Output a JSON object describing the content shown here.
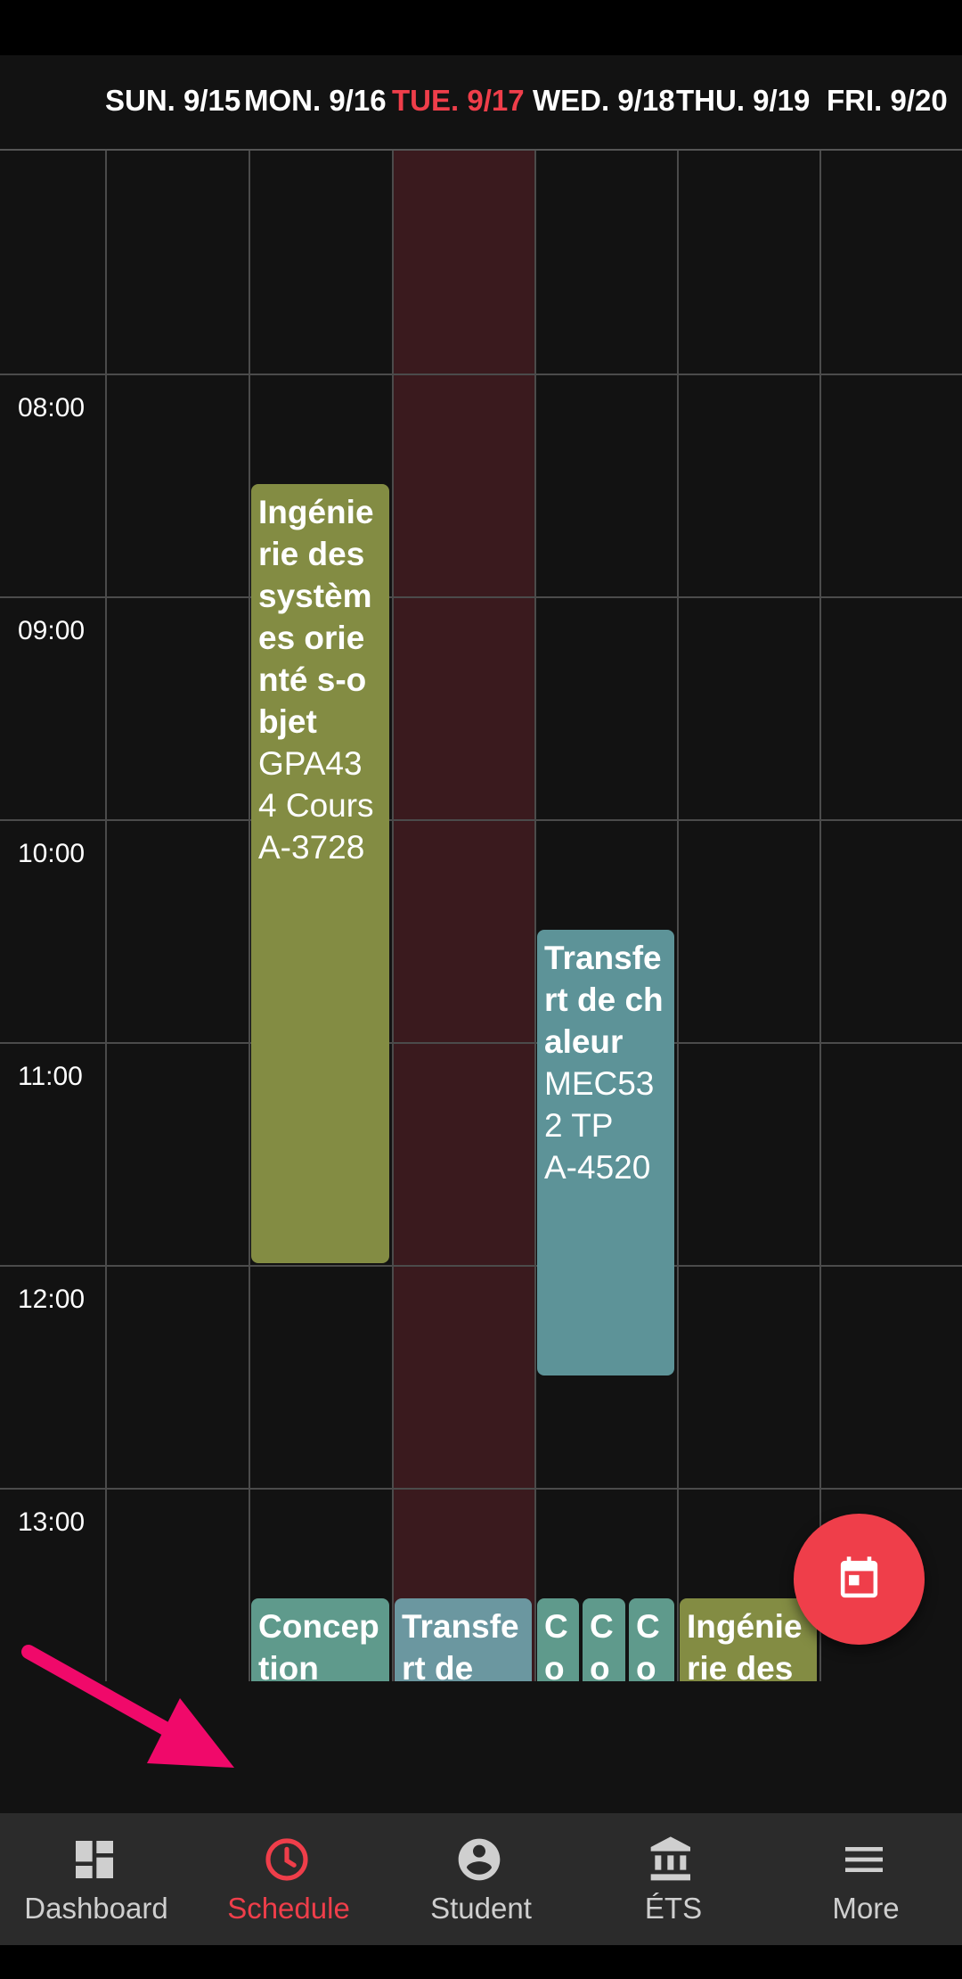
{
  "header": {
    "days": [
      {
        "label": "SUN. 9/15",
        "today": false
      },
      {
        "label": "MON. 9/16",
        "today": false
      },
      {
        "label": "TUE. 9/17",
        "today": true
      },
      {
        "label": "WED. 9/18",
        "today": false
      },
      {
        "label": "THU. 9/19",
        "today": false
      },
      {
        "label": "FRI. 9/20",
        "today": false
      }
    ]
  },
  "times": [
    "08:00",
    "09:00",
    "10:00",
    "11:00",
    "12:00",
    "13:00"
  ],
  "events": [
    {
      "title": "Ingénie rie des systèm es orienté s-objet",
      "lines": [
        "GPA43 4 Cours",
        "A-3728"
      ],
      "color": "#838c43"
    },
    {
      "title": "Transfe rt de chaleur",
      "lines": [
        "MEC53 2 TP",
        "A-4520"
      ],
      "color": "#5d9398"
    },
    {
      "title": "Concep tion",
      "lines": [],
      "color": "#5f9a8c"
    },
    {
      "title": "Transfe rt de",
      "lines": [],
      "color": "#6b97a0"
    },
    {
      "title": "C o",
      "lines": [],
      "color": "#5f9a8c"
    },
    {
      "title": "C o",
      "lines": [],
      "color": "#5f9a8c"
    },
    {
      "title": "C o",
      "lines": [],
      "color": "#5f9a8c"
    },
    {
      "title": "Ingénie rie des",
      "lines": [],
      "color": "#838c43"
    }
  ],
  "colors": {
    "accent": "#ef3e4a",
    "today_column": "#3a1a1e"
  },
  "fab": {
    "icon": "calendar-today-icon"
  },
  "nav": [
    {
      "label": "Dashboard",
      "icon": "dashboard-icon",
      "active": false
    },
    {
      "label": "Schedule",
      "icon": "clock-icon",
      "active": true
    },
    {
      "label": "Student",
      "icon": "account-circle-icon",
      "active": false
    },
    {
      "label": "ÉTS",
      "icon": "institution-icon",
      "active": false
    },
    {
      "label": "More",
      "icon": "menu-icon",
      "active": false
    }
  ]
}
